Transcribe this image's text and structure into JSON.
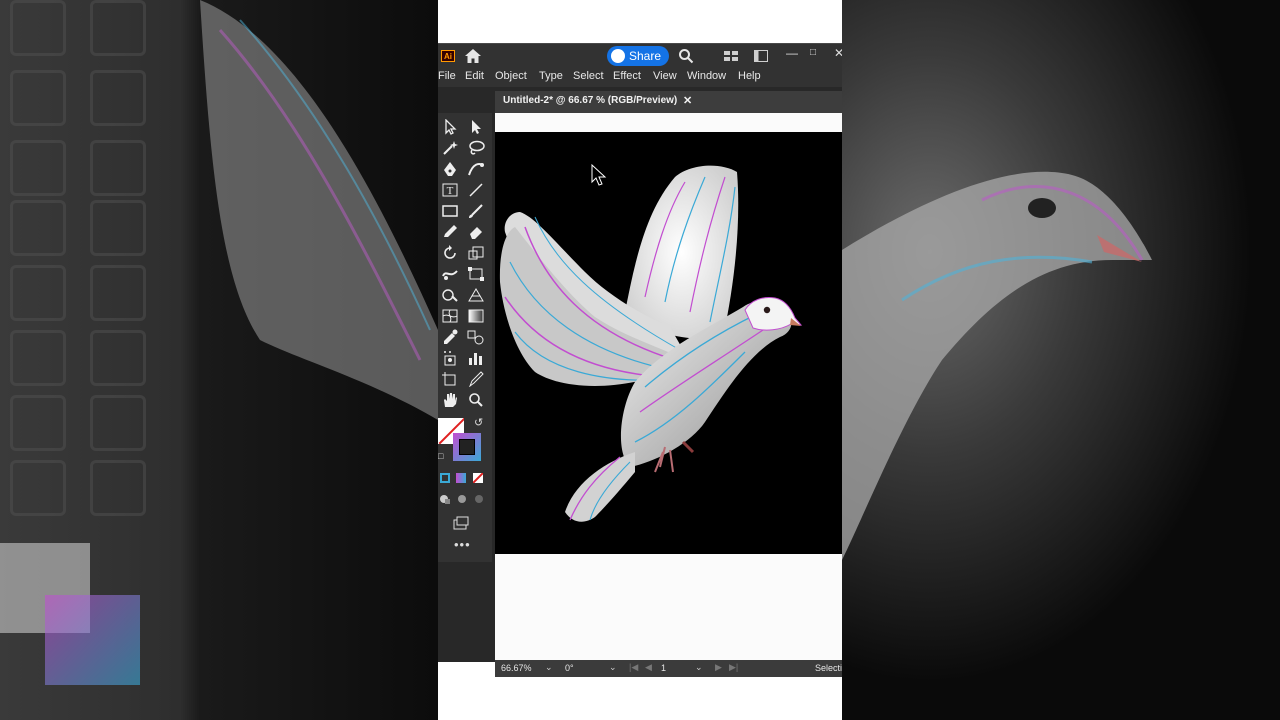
{
  "app": {
    "share_label": "Share",
    "menu": [
      "File",
      "Edit",
      "Object",
      "Type",
      "Select",
      "Effect",
      "View",
      "Window",
      "Help"
    ],
    "document_tab": "Untitled-2* @ 66.67 % (RGB/Preview)"
  },
  "status": {
    "zoom": "66.67%",
    "rotation": "0°",
    "artboard": "1",
    "tool": "Selecti"
  },
  "colors": {
    "accent": "#1473e6",
    "ui_dark": "#323232",
    "artboard_bg": "#000000"
  }
}
